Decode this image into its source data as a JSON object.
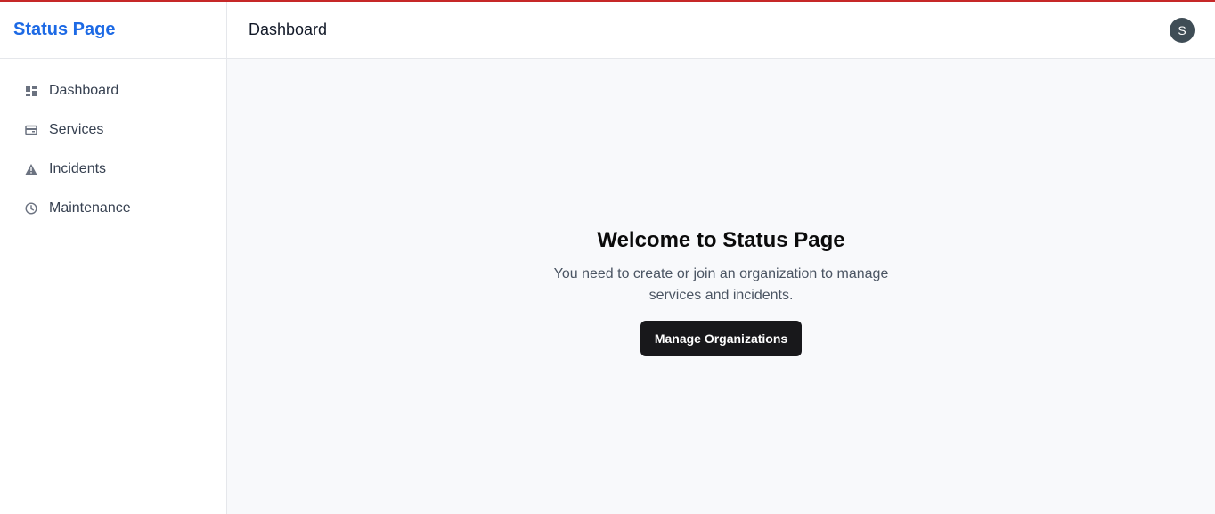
{
  "brand": {
    "title": "Status Page"
  },
  "header": {
    "title": "Dashboard",
    "avatar_initial": "S"
  },
  "sidebar": {
    "items": [
      {
        "label": "Dashboard",
        "icon": "dashboard-icon"
      },
      {
        "label": "Services",
        "icon": "services-icon"
      },
      {
        "label": "Incidents",
        "icon": "warning-icon"
      },
      {
        "label": "Maintenance",
        "icon": "clock-icon"
      }
    ]
  },
  "main": {
    "welcome_title": "Welcome to Status Page",
    "welcome_text": "You need to create or join an organization to manage services and incidents.",
    "button_label": "Manage Organizations"
  },
  "colors": {
    "brand": "#1d6ae5",
    "top_accent": "#c62828",
    "button_bg": "#18181b",
    "avatar_bg": "#3f4d56",
    "main_bg": "#f8f9fb"
  }
}
